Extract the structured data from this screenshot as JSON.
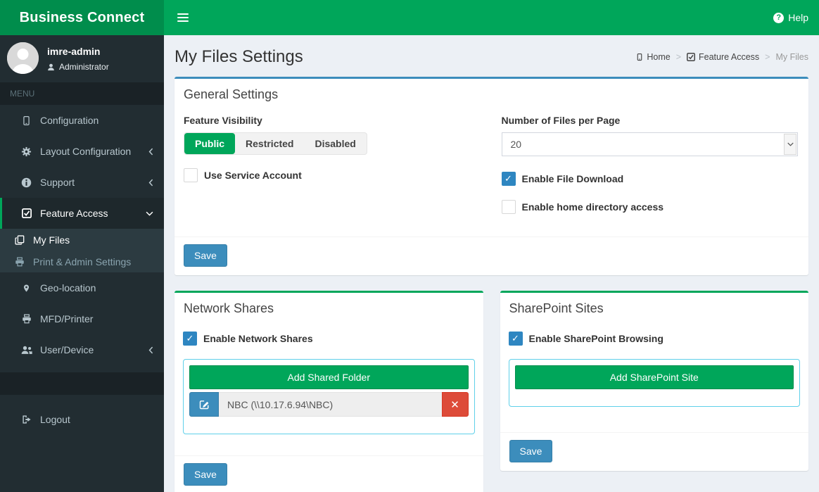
{
  "app": {
    "brand": "Business Connect",
    "help_label": "Help"
  },
  "user": {
    "name": "imre-admin",
    "role": "Administrator"
  },
  "sidebar": {
    "menu_header": "MENU",
    "items": [
      {
        "label": "Configuration"
      },
      {
        "label": "Layout Configuration"
      },
      {
        "label": "Support"
      },
      {
        "label": "Feature Access"
      },
      {
        "label": "My Files"
      },
      {
        "label": "Print & Admin Settings"
      },
      {
        "label": "Geo-location"
      },
      {
        "label": "MFD/Printer"
      },
      {
        "label": "User/Device"
      },
      {
        "label": "Logout"
      }
    ]
  },
  "page": {
    "title": "My Files Settings",
    "breadcrumb": {
      "home": "Home",
      "section": "Feature Access",
      "current": "My Files"
    }
  },
  "general": {
    "title": "General Settings",
    "feature_visibility_label": "Feature Visibility",
    "visibility_options": [
      "Public",
      "Restricted",
      "Disabled"
    ],
    "selected_visibility": "Public",
    "use_service_account_label": "Use Service Account",
    "use_service_account_checked": false,
    "files_per_page_label": "Number of Files per Page",
    "files_per_page_value": "20",
    "enable_file_download_label": "Enable File Download",
    "enable_file_download_checked": true,
    "enable_home_directory_label": "Enable home directory access",
    "enable_home_directory_checked": false,
    "save_label": "Save"
  },
  "network_shares": {
    "title": "Network Shares",
    "enable_label": "Enable Network Shares",
    "enable_checked": true,
    "add_button_label": "Add Shared Folder",
    "shares": [
      {
        "name": "NBC (\\\\10.17.6.94\\NBC)"
      }
    ],
    "save_label": "Save"
  },
  "sharepoint": {
    "title": "SharePoint Sites",
    "enable_label": "Enable SharePoint Browsing",
    "enable_checked": true,
    "add_button_label": "Add SharePoint Site",
    "save_label": "Save"
  },
  "colors": {
    "navbar_green": "#00a65a",
    "logo_green": "#008d4c",
    "sidebar_dark": "#222d32",
    "primary_blue": "#3c8dbc",
    "checkbox_blue": "#2e86c1",
    "danger_red": "#dd4b39",
    "inner_border_cyan": "#5fd0ea",
    "content_bg": "#ecf0f5"
  }
}
